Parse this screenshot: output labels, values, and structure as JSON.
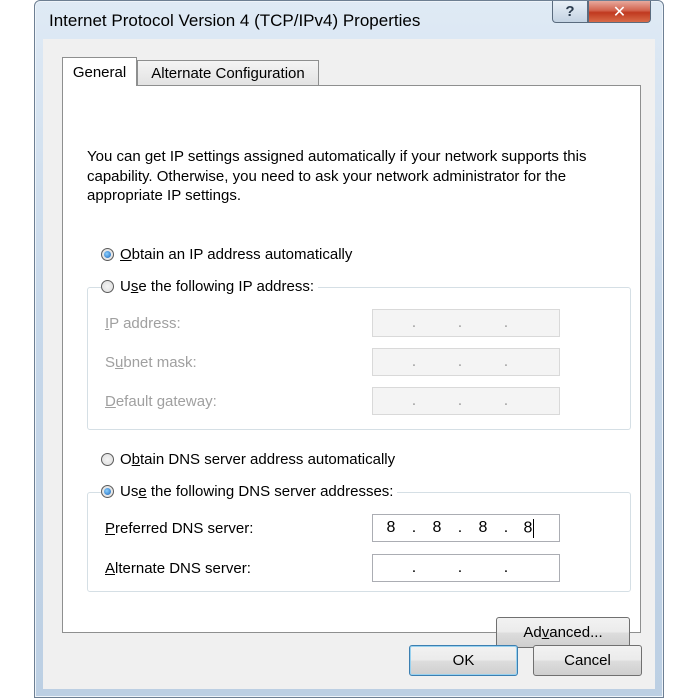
{
  "window": {
    "title": "Internet Protocol Version 4 (TCP/IPv4) Properties",
    "help_icon": "help-icon",
    "close_icon": "close-icon"
  },
  "tabs": [
    {
      "label": "General",
      "selected": true
    },
    {
      "label": "Alternate Configuration",
      "selected": false
    }
  ],
  "description": "You can get IP settings assigned automatically if your network supports this capability. Otherwise, you need to ask your network administrator for the appropriate IP settings.",
  "ip": {
    "auto_radio": {
      "before": "",
      "key": "O",
      "after": "btain an IP address automatically",
      "checked": true
    },
    "manual_radio": {
      "before": "U",
      "key": "s",
      "after": "e the following IP address:",
      "checked": false
    },
    "fields": [
      {
        "before": "",
        "key": "I",
        "after": "P address:",
        "value": [
          "",
          "",
          "",
          ""
        ],
        "enabled": false
      },
      {
        "before": "S",
        "key": "u",
        "after": "bnet mask:",
        "value": [
          "",
          "",
          "",
          ""
        ],
        "enabled": false
      },
      {
        "before": "",
        "key": "D",
        "after": "efault gateway:",
        "value": [
          "",
          "",
          "",
          ""
        ],
        "enabled": false
      }
    ]
  },
  "dns": {
    "auto_radio": {
      "before": "O",
      "key": "b",
      "after": "tain DNS server address automatically",
      "checked": false
    },
    "manual_radio": {
      "before": "Us",
      "key": "e",
      "after": " the following DNS server addresses:",
      "checked": true
    },
    "fields": [
      {
        "before": "",
        "key": "P",
        "after": "referred DNS server:",
        "value": [
          "8",
          "8",
          "8",
          "8"
        ],
        "enabled": true
      },
      {
        "before": "",
        "key": "A",
        "after": "lternate DNS server:",
        "value": [
          "",
          "",
          "",
          ""
        ],
        "enabled": true
      }
    ]
  },
  "buttons": {
    "advanced": {
      "before": "Ad",
      "key": "v",
      "after": "anced..."
    },
    "ok": "OK",
    "cancel": "Cancel"
  },
  "colors": {
    "title_bar": "#c7d8ea",
    "close_button": "#c0391f",
    "radio_selected": "#1a63b8"
  }
}
